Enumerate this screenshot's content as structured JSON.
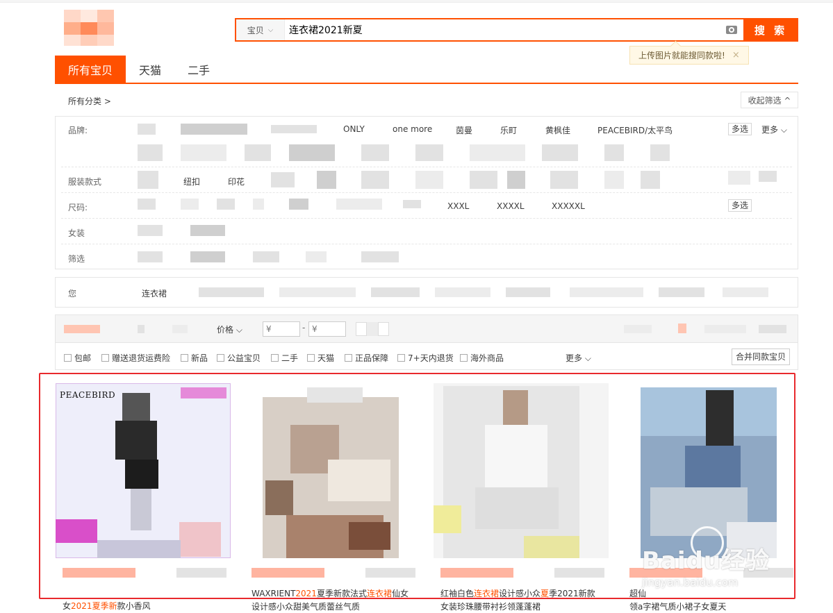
{
  "search": {
    "scope_label": "宝贝",
    "query": "连衣裙2021新夏",
    "button_label": "搜 索"
  },
  "upload_tip": {
    "text": "上传图片就能搜同款啦!",
    "close": "×"
  },
  "tabs": [
    {
      "label": "所有宝贝"
    },
    {
      "label": "天猫"
    },
    {
      "label": "二手"
    }
  ],
  "breadcrumb": "所有分类 >",
  "collapse_label": "收起筛选 ^",
  "filters": {
    "brand": {
      "label": "品牌:",
      "values": [
        "ONLY",
        "one more",
        "茵曼",
        "乐町",
        "黄枫佳",
        "PEACEBIRD/太平鸟"
      ],
      "multi": "多选",
      "more": "更多"
    },
    "style": {
      "label": "服装款式",
      "values": [
        "纽扣",
        "印花"
      ]
    },
    "size": {
      "label": "尺码:",
      "values": [
        "XXXL",
        "XXXXL",
        "XXXXXL"
      ],
      "multi": "多选"
    },
    "women": {
      "label": "女装"
    },
    "screen": {
      "label": "筛选"
    }
  },
  "related": {
    "label": "您",
    "query": "连衣裙"
  },
  "sort": {
    "price_label": "价格",
    "price_min_placeholder": "¥",
    "price_max_placeholder": "¥",
    "dash": "-"
  },
  "checks": [
    "包邮",
    "赠送退货运费险",
    "新品",
    "公益宝贝",
    "二手",
    "天猫",
    "正品保障",
    "7+天内退货",
    "海外商品"
  ],
  "checks_more": "更多",
  "merge_label": "合并同款宝贝",
  "items": [
    {
      "brand_mark": "PEACEBIRD",
      "t1": "女",
      "t2": "2021",
      "t3": "夏季",
      "t4": "新",
      "t5": "款小香风",
      "line2": ""
    },
    {
      "brand_mark": "",
      "t1": "WAXRIENT",
      "t2": "2021",
      "t3": "夏季新款法式",
      "t4": "连衣裙",
      "t5": "仙女",
      "line2": "设计感小众甜美气质蕾丝气质"
    },
    {
      "brand_mark": "",
      "t1": "红袖白色",
      "t2": "连衣裙",
      "t3": "设计感小众",
      "t4": "夏",
      "t5": "季2021新款",
      "line2": "女装珍珠腰带衬衫领蓬蓬裙"
    },
    {
      "brand_mark": "",
      "t1": "超仙",
      "t2": "",
      "t3": "",
      "t4": "",
      "t5": "",
      "line2": "领a字裙气质小裙子女夏天"
    }
  ],
  "watermark": {
    "logo": "Baidu经验",
    "url": "jingyan.baidu.com"
  },
  "colors": {
    "accent": "#ff5000",
    "highlight_border": "#e8292c"
  }
}
